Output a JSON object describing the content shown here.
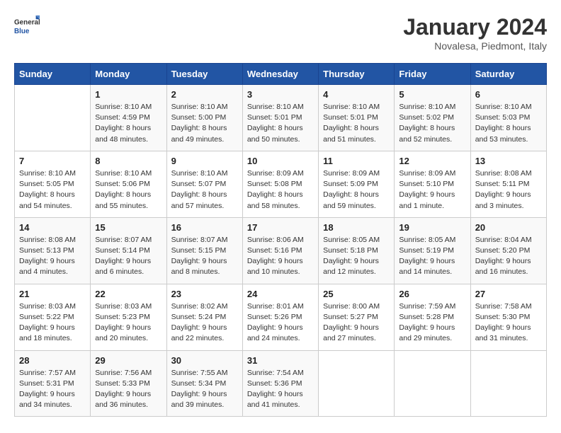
{
  "header": {
    "logo_line1": "General",
    "logo_line2": "Blue",
    "month_title": "January 2024",
    "location": "Novalesa, Piedmont, Italy"
  },
  "weekdays": [
    "Sunday",
    "Monday",
    "Tuesday",
    "Wednesday",
    "Thursday",
    "Friday",
    "Saturday"
  ],
  "weeks": [
    [
      {
        "day": "",
        "info": ""
      },
      {
        "day": "1",
        "info": "Sunrise: 8:10 AM\nSunset: 4:59 PM\nDaylight: 8 hours\nand 48 minutes."
      },
      {
        "day": "2",
        "info": "Sunrise: 8:10 AM\nSunset: 5:00 PM\nDaylight: 8 hours\nand 49 minutes."
      },
      {
        "day": "3",
        "info": "Sunrise: 8:10 AM\nSunset: 5:01 PM\nDaylight: 8 hours\nand 50 minutes."
      },
      {
        "day": "4",
        "info": "Sunrise: 8:10 AM\nSunset: 5:01 PM\nDaylight: 8 hours\nand 51 minutes."
      },
      {
        "day": "5",
        "info": "Sunrise: 8:10 AM\nSunset: 5:02 PM\nDaylight: 8 hours\nand 52 minutes."
      },
      {
        "day": "6",
        "info": "Sunrise: 8:10 AM\nSunset: 5:03 PM\nDaylight: 8 hours\nand 53 minutes."
      }
    ],
    [
      {
        "day": "7",
        "info": "Sunrise: 8:10 AM\nSunset: 5:05 PM\nDaylight: 8 hours\nand 54 minutes."
      },
      {
        "day": "8",
        "info": "Sunrise: 8:10 AM\nSunset: 5:06 PM\nDaylight: 8 hours\nand 55 minutes."
      },
      {
        "day": "9",
        "info": "Sunrise: 8:10 AM\nSunset: 5:07 PM\nDaylight: 8 hours\nand 57 minutes."
      },
      {
        "day": "10",
        "info": "Sunrise: 8:09 AM\nSunset: 5:08 PM\nDaylight: 8 hours\nand 58 minutes."
      },
      {
        "day": "11",
        "info": "Sunrise: 8:09 AM\nSunset: 5:09 PM\nDaylight: 8 hours\nand 59 minutes."
      },
      {
        "day": "12",
        "info": "Sunrise: 8:09 AM\nSunset: 5:10 PM\nDaylight: 9 hours\nand 1 minute."
      },
      {
        "day": "13",
        "info": "Sunrise: 8:08 AM\nSunset: 5:11 PM\nDaylight: 9 hours\nand 3 minutes."
      }
    ],
    [
      {
        "day": "14",
        "info": "Sunrise: 8:08 AM\nSunset: 5:13 PM\nDaylight: 9 hours\nand 4 minutes."
      },
      {
        "day": "15",
        "info": "Sunrise: 8:07 AM\nSunset: 5:14 PM\nDaylight: 9 hours\nand 6 minutes."
      },
      {
        "day": "16",
        "info": "Sunrise: 8:07 AM\nSunset: 5:15 PM\nDaylight: 9 hours\nand 8 minutes."
      },
      {
        "day": "17",
        "info": "Sunrise: 8:06 AM\nSunset: 5:16 PM\nDaylight: 9 hours\nand 10 minutes."
      },
      {
        "day": "18",
        "info": "Sunrise: 8:05 AM\nSunset: 5:18 PM\nDaylight: 9 hours\nand 12 minutes."
      },
      {
        "day": "19",
        "info": "Sunrise: 8:05 AM\nSunset: 5:19 PM\nDaylight: 9 hours\nand 14 minutes."
      },
      {
        "day": "20",
        "info": "Sunrise: 8:04 AM\nSunset: 5:20 PM\nDaylight: 9 hours\nand 16 minutes."
      }
    ],
    [
      {
        "day": "21",
        "info": "Sunrise: 8:03 AM\nSunset: 5:22 PM\nDaylight: 9 hours\nand 18 minutes."
      },
      {
        "day": "22",
        "info": "Sunrise: 8:03 AM\nSunset: 5:23 PM\nDaylight: 9 hours\nand 20 minutes."
      },
      {
        "day": "23",
        "info": "Sunrise: 8:02 AM\nSunset: 5:24 PM\nDaylight: 9 hours\nand 22 minutes."
      },
      {
        "day": "24",
        "info": "Sunrise: 8:01 AM\nSunset: 5:26 PM\nDaylight: 9 hours\nand 24 minutes."
      },
      {
        "day": "25",
        "info": "Sunrise: 8:00 AM\nSunset: 5:27 PM\nDaylight: 9 hours\nand 27 minutes."
      },
      {
        "day": "26",
        "info": "Sunrise: 7:59 AM\nSunset: 5:28 PM\nDaylight: 9 hours\nand 29 minutes."
      },
      {
        "day": "27",
        "info": "Sunrise: 7:58 AM\nSunset: 5:30 PM\nDaylight: 9 hours\nand 31 minutes."
      }
    ],
    [
      {
        "day": "28",
        "info": "Sunrise: 7:57 AM\nSunset: 5:31 PM\nDaylight: 9 hours\nand 34 minutes."
      },
      {
        "day": "29",
        "info": "Sunrise: 7:56 AM\nSunset: 5:33 PM\nDaylight: 9 hours\nand 36 minutes."
      },
      {
        "day": "30",
        "info": "Sunrise: 7:55 AM\nSunset: 5:34 PM\nDaylight: 9 hours\nand 39 minutes."
      },
      {
        "day": "31",
        "info": "Sunrise: 7:54 AM\nSunset: 5:36 PM\nDaylight: 9 hours\nand 41 minutes."
      },
      {
        "day": "",
        "info": ""
      },
      {
        "day": "",
        "info": ""
      },
      {
        "day": "",
        "info": ""
      }
    ]
  ]
}
